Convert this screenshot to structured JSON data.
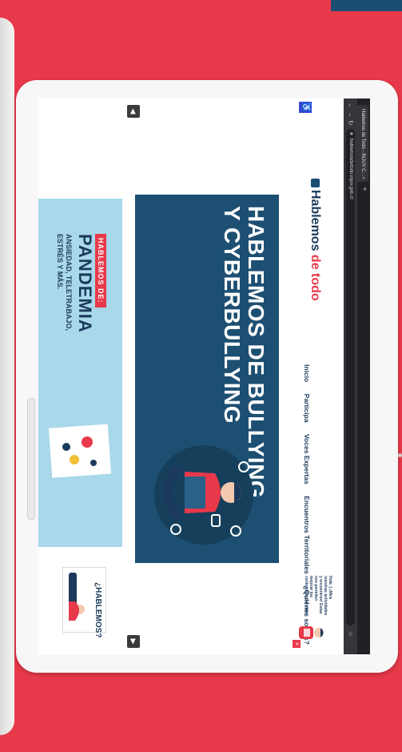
{
  "browser": {
    "tab_title": "Hablemos de Todo - INJUV C…",
    "tab_close": "×",
    "new_tab": "+",
    "url": "hablemosdetodo.injuv.gob.cl"
  },
  "site": {
    "logo_text": "Hablemos ",
    "logo_accent": "de todo",
    "nav": [
      "Inicio",
      "Participa",
      "Voces Expertas",
      "Encuentros Territoriales",
      "¿Quiénes somos?"
    ],
    "chat_text": "Hola :) ¡Mira nuestras actividades y encuentros! Estas nos permiten mejorar los contenidos del sitio.",
    "chat_close": "×"
  },
  "hero": {
    "title_line1": "HABLEMOS DE BULLYING",
    "title_line2": "Y CYBERBULLYING"
  },
  "banner": {
    "tag": "HABLEMOS DE:",
    "title": "PANDEMIA",
    "subtitle": "ANSIEDAD, TELETRABAJO, ESTRÉS Y MÁS."
  },
  "card": {
    "text": "¿HABLEMOS?"
  },
  "colors": {
    "background": "#e8394a",
    "navy": "#1d4f72",
    "light_blue": "#a9d8ea"
  }
}
